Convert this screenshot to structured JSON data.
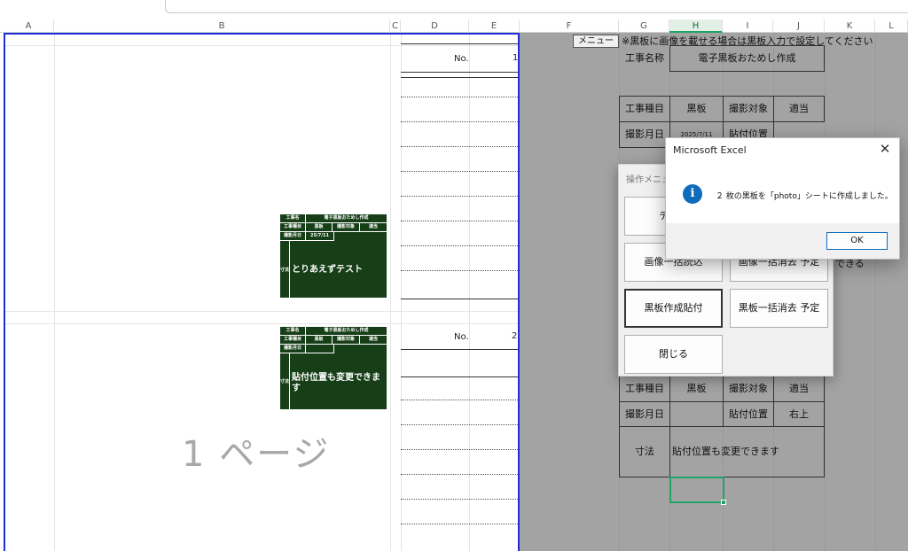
{
  "column_headers": [
    "A",
    "B",
    "C",
    "D",
    "E",
    "F",
    "G",
    "H",
    "I",
    "J",
    "K",
    "L"
  ],
  "print_area": {
    "page_watermark": "1 ページ",
    "photos": [
      {
        "no_label": "No.",
        "no_value": "1"
      },
      {
        "no_label": "No.",
        "no_value": "2"
      }
    ],
    "boards": [
      {
        "r1": [
          "工事名",
          "電子黒板おためし作成"
        ],
        "r2": [
          "工事種目",
          "黒板",
          "撮影対象",
          "適当"
        ],
        "r3": [
          "撮影月日",
          "25/7/11"
        ],
        "r4": [
          "寸法",
          "とりあえずテスト"
        ]
      },
      {
        "r1": [
          "工事名",
          "電子黒板おためし作成"
        ],
        "r2": [
          "工事種目",
          "黒板",
          "撮影対象",
          "適当"
        ],
        "r3": [
          "撮影月日",
          ""
        ],
        "r4": [
          "寸法",
          "貼付位置も変更できます"
        ]
      }
    ]
  },
  "settings": {
    "menu_button": "メニュー",
    "note": "※黒板に画像を載せる場合は黒板入力で設定してください",
    "project": {
      "label": "工事名称",
      "value": "電子黒板おためし作成"
    },
    "board1": {
      "r1": [
        "工事種目",
        "黒板",
        "撮影対象",
        "適当"
      ],
      "r2": [
        "撮影月日",
        "2025/7/11",
        "貼付位置"
      ]
    },
    "board2": {
      "r1": [
        "工事種目",
        "黒板",
        "撮影対象",
        "適当"
      ],
      "r2": [
        "撮影月日",
        "",
        "貼付位置",
        "右上"
      ],
      "r3": [
        "寸法",
        "貼付位置も変更できます"
      ]
    }
  },
  "operation_menu": {
    "title": "操作メニュー",
    "buttons": {
      "template": "テンプ",
      "image_import": "画像一括読込",
      "image_clear": "画像一括消去 予定",
      "board_create": "黒板作成貼付",
      "board_clear": "黒板一括消去 予定",
      "close": "閉じる"
    },
    "trailing_text": "できる"
  },
  "dialog": {
    "title": "Microsoft Excel",
    "icon": "i",
    "message": "２ 枚の黒板を「photo」シートに作成しました。",
    "ok": "OK",
    "close_glyph": "✕"
  }
}
